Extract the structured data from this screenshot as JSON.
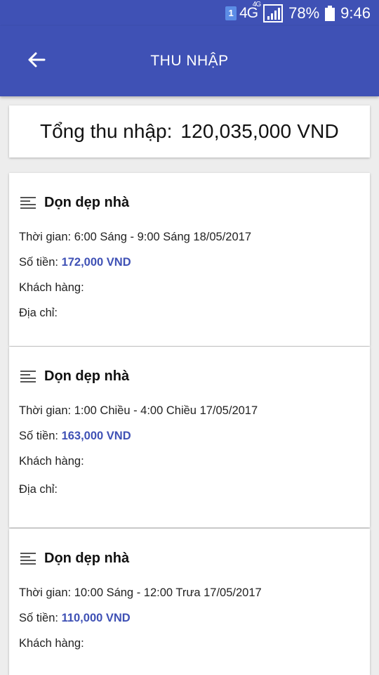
{
  "status_bar": {
    "sim": "1",
    "network": "4G",
    "network_sup": "4G",
    "battery_percent": "78%",
    "time": "9:46"
  },
  "app_bar": {
    "title": "THU NHẬP",
    "back_icon": "arrow-left-icon"
  },
  "summary": {
    "label": "Tổng thu nhập:",
    "value": "120,035,000 VND"
  },
  "jobs": [
    {
      "title": "Dọn dẹp nhà",
      "time_label": "Thời gian:",
      "time": "6:00 Sáng - 9:00 Sáng 18/05/2017",
      "amount_label": "Số tiền:",
      "amount": "172,000 VND",
      "customer_label": "Khách hàng:",
      "address_label": "Địa chỉ:"
    },
    {
      "title": "Dọn dẹp nhà",
      "time_label": "Thời gian:",
      "time": "1:00 Chiều - 4:00 Chiều 17/05/2017",
      "amount_label": "Số tiền:",
      "amount": "163,000 VND",
      "customer_label": "Khách hàng:",
      "address_label": "Địa chỉ:"
    },
    {
      "title": "Dọn dẹp nhà",
      "time_label": "Thời gian:",
      "time": "10:00 Sáng - 12:00 Trưa 17/05/2017",
      "amount_label": "Số tiền:",
      "amount": "110,000 VND",
      "customer_label": "Khách hàng:"
    }
  ],
  "colors": {
    "primary": "#3f51b5",
    "background": "#ededed",
    "card": "#ffffff",
    "amount": "#3f51b5"
  }
}
